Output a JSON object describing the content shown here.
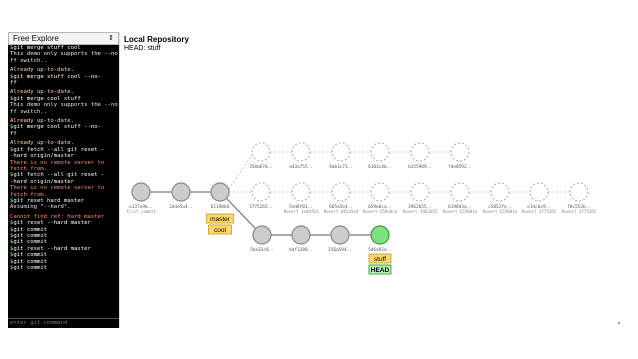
{
  "mode_selector": {
    "value": "Free Explore",
    "arrows": "⇕"
  },
  "console": {
    "lines": [
      {
        "type": "cmd",
        "prompt": "$",
        "text": "git merge stuff cool"
      },
      {
        "type": "info",
        "text": "This demo only supports the --no-"
      },
      {
        "type": "info",
        "text": "ff switch.."
      },
      {
        "type": "gap"
      },
      {
        "type": "warn",
        "text": "Already up-to-date."
      },
      {
        "type": "cmd",
        "prompt": "$",
        "text": "git merge stuff cool --no-"
      },
      {
        "type": "cmd",
        "prompt": "",
        "text": "ff"
      },
      {
        "type": "gap"
      },
      {
        "type": "warn",
        "text": "Already up-to-date."
      },
      {
        "type": "cmd",
        "prompt": "$",
        "text": "git merge cool stuff"
      },
      {
        "type": "info",
        "text": "This demo only supports the --no-"
      },
      {
        "type": "info",
        "text": "ff switch.."
      },
      {
        "type": "gap"
      },
      {
        "type": "warn",
        "text": "Already up-to-date."
      },
      {
        "type": "cmd",
        "prompt": "$",
        "text": "git merge cool stuff --no-"
      },
      {
        "type": "cmd",
        "prompt": "",
        "text": "ff"
      },
      {
        "type": "gap"
      },
      {
        "type": "warn",
        "text": "Already up-to-date."
      },
      {
        "type": "cmd",
        "prompt": "$",
        "text": "git fetch --all git reset -"
      },
      {
        "type": "cmd",
        "prompt": "",
        "text": "-hard origin/master"
      },
      {
        "type": "err",
        "text": "There is no remote server to"
      },
      {
        "type": "err",
        "text": "fetch from."
      },
      {
        "type": "cmd",
        "prompt": "$",
        "text": "git fetch --all git reset -"
      },
      {
        "type": "cmd",
        "prompt": "",
        "text": "-hard origin/master"
      },
      {
        "type": "err",
        "text": "There is no remote server to"
      },
      {
        "type": "err",
        "text": "fetch from."
      },
      {
        "type": "cmd",
        "prompt": "$",
        "text": "git reset hard master"
      },
      {
        "type": "info",
        "text": "Assuming \"--hard\"."
      },
      {
        "type": "gap"
      },
      {
        "type": "err",
        "text": "Cannot find ref: hard master"
      },
      {
        "type": "cmd",
        "prompt": "$",
        "text": "git reset --hard master"
      },
      {
        "type": "cmd",
        "prompt": "$",
        "text": "git commit"
      },
      {
        "type": "cmd",
        "prompt": "$",
        "text": "git commit"
      },
      {
        "type": "cmd",
        "prompt": "$",
        "text": "git commit"
      },
      {
        "type": "cmd",
        "prompt": "$",
        "text": "git reset --hard master"
      },
      {
        "type": "cmd",
        "prompt": "$",
        "text": "git commit"
      },
      {
        "type": "cmd",
        "prompt": "$",
        "text": "git commit"
      },
      {
        "type": "cmd",
        "prompt": "$",
        "text": "git commit"
      }
    ],
    "input_placeholder": "enter git command"
  },
  "repository": {
    "title": "Local Repository",
    "head": "HEAD: stuff",
    "commits_main": [
      {
        "id": "e137e9b..",
        "msg": "first commit",
        "style": "solid"
      },
      {
        "id": "2dde5a4..",
        "msg": "",
        "style": "solid"
      },
      {
        "id": "61198b4",
        "msg": "",
        "style": "solid"
      }
    ],
    "commits_branch": [
      {
        "id": "5ba33c8..",
        "style": "solid"
      },
      {
        "id": "bdf3280..",
        "style": "solid"
      },
      {
        "id": "156a594..",
        "style": "solid"
      },
      {
        "id": "5d6a92e..",
        "style": "head"
      }
    ],
    "commits_dashed_top": [
      {
        "id": "358a670.."
      },
      {
        "id": "a43a755.."
      },
      {
        "id": "9ab3c73.."
      },
      {
        "id": "6103c4b.."
      },
      {
        "id": "b355989.."
      },
      {
        "id": "fde0592.."
      }
    ],
    "commits_dashed_mid": [
      {
        "id": "3775265..",
        "msg": ""
      },
      {
        "id": "5ed8f01..",
        "msg": "Revert 3ed8f01"
      },
      {
        "id": "665a5e4..",
        "msg": "Revert 665a5e4"
      },
      {
        "id": "659e6ca..",
        "msg": "Revert 659e6ca"
      },
      {
        "id": "3962b55..",
        "msg": "Revert 3962b55"
      },
      {
        "id": "6198d3a..",
        "msg": "Revert 6198d3a"
      },
      {
        "id": "c5852fe..",
        "msg": "Revert 6198d3a"
      },
      {
        "id": "e1dc6e9..",
        "msg": "Revert 3775265"
      },
      {
        "id": "f8c553b..",
        "msg": "Revert 3775265"
      }
    ],
    "tags": {
      "master": "master",
      "cool": "cool",
      "stuff": "stuff",
      "head": "HEAD"
    }
  },
  "colors": {
    "node_fill": "#cccccc",
    "node_stroke": "#888888",
    "head_fill": "#7ee07e",
    "head_stroke": "#3c9a3c",
    "tag_fill": "#ffd86b",
    "tag_stroke": "#c49b1f",
    "head_tag_fill": "#b8f0b0",
    "head_tag_stroke": "#2e8b2e"
  }
}
